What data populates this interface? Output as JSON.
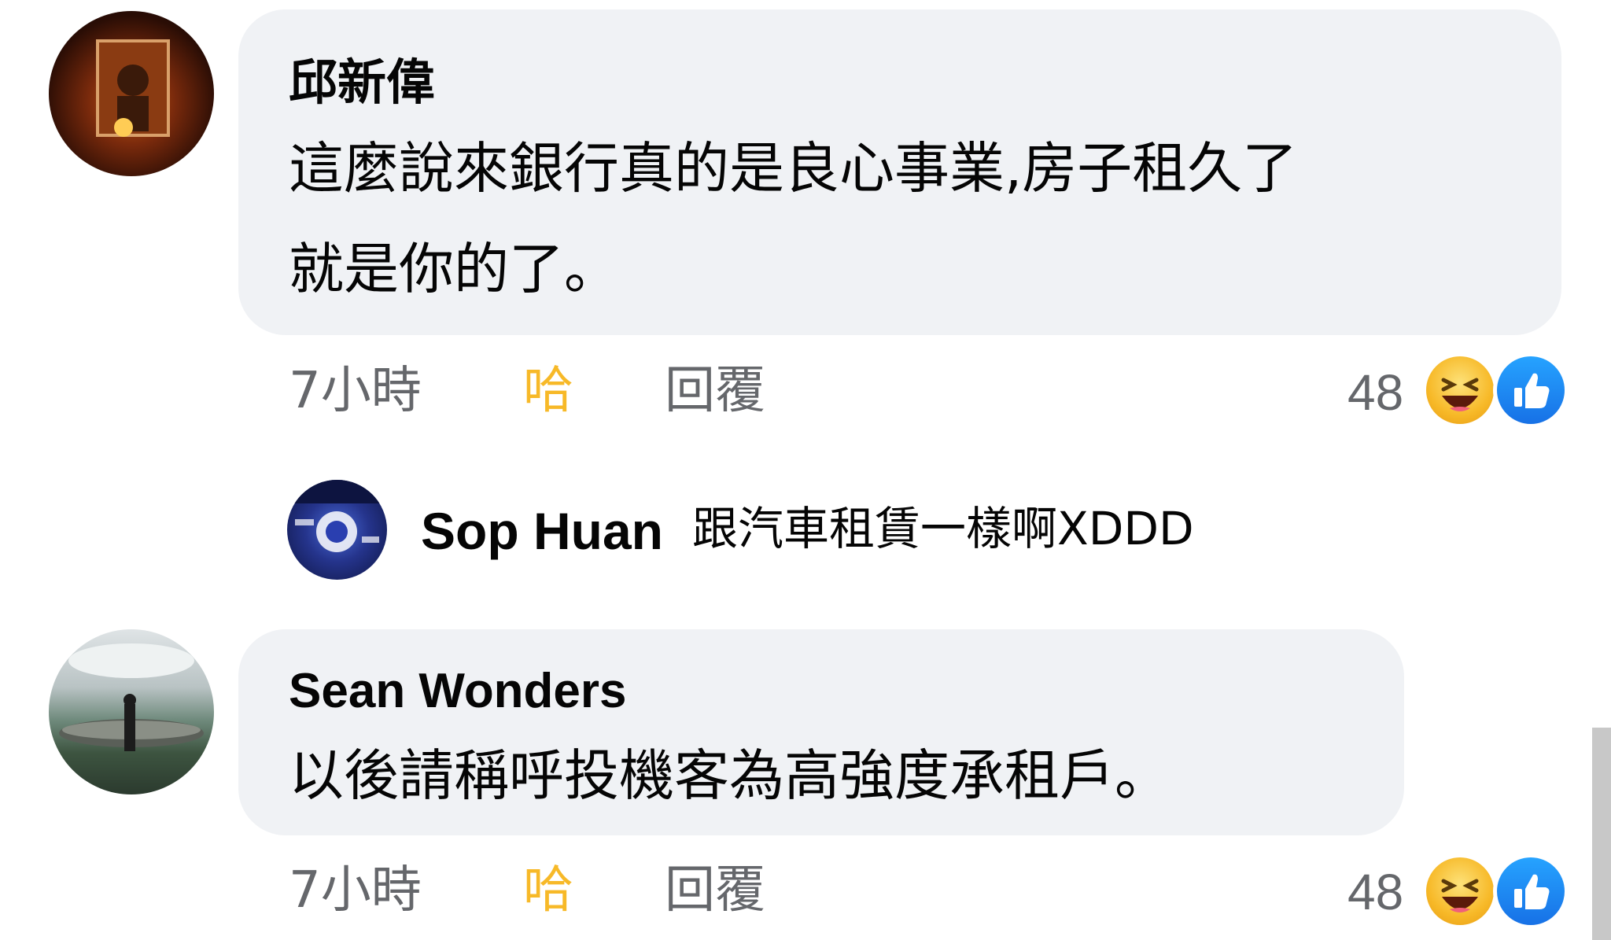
{
  "comments": [
    {
      "author": "邱新偉",
      "text_lines": [
        "這麼說來銀行真的是良心事業,房子租久了",
        "就是你的了。"
      ],
      "time": "7小時",
      "reaction_label": "哈",
      "reply_label": "回覆",
      "reaction_count": "48",
      "reaction_icons": [
        "haha-emoji-icon",
        "like-thumb-icon"
      ],
      "reply": {
        "author": "Sop Huan",
        "text": "跟汽車租賃一樣啊XDDD"
      }
    },
    {
      "author": "Sean Wonders",
      "text_lines": [
        "以後請稱呼投機客為高強度承租戶。"
      ],
      "time": "7小時",
      "reaction_label": "哈",
      "reply_label": "回覆",
      "reaction_count": "48",
      "reaction_icons": [
        "haha-emoji-icon",
        "like-thumb-icon"
      ]
    }
  ],
  "colors": {
    "bubble": "#f0f2f5",
    "meta": "#65676b",
    "haha_accent": "#f7b928",
    "like_blue": "#1877f2"
  }
}
